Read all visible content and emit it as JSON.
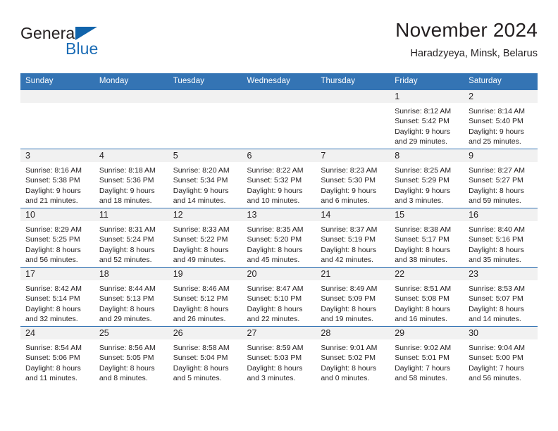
{
  "brand": {
    "name_top": "General",
    "name_bottom": "Blue",
    "triangle_color": "#1164ab",
    "blue_text_color": "#1b6cb5"
  },
  "header": {
    "title": "November 2024",
    "subtitle": "Haradzyeya, Minsk, Belarus"
  },
  "theme": {
    "header_blue": "#3474b4",
    "daynum_gray": "#f1f1f1",
    "text_color": "#231f20"
  },
  "weekdays": [
    "Sunday",
    "Monday",
    "Tuesday",
    "Wednesday",
    "Thursday",
    "Friday",
    "Saturday"
  ],
  "weeks": [
    [
      {
        "day": "",
        "lines": []
      },
      {
        "day": "",
        "lines": []
      },
      {
        "day": "",
        "lines": []
      },
      {
        "day": "",
        "lines": []
      },
      {
        "day": "",
        "lines": []
      },
      {
        "day": "1",
        "lines": [
          "Sunrise: 8:12 AM",
          "Sunset: 5:42 PM",
          "Daylight: 9 hours",
          "and 29 minutes."
        ]
      },
      {
        "day": "2",
        "lines": [
          "Sunrise: 8:14 AM",
          "Sunset: 5:40 PM",
          "Daylight: 9 hours",
          "and 25 minutes."
        ]
      }
    ],
    [
      {
        "day": "3",
        "lines": [
          "Sunrise: 8:16 AM",
          "Sunset: 5:38 PM",
          "Daylight: 9 hours",
          "and 21 minutes."
        ]
      },
      {
        "day": "4",
        "lines": [
          "Sunrise: 8:18 AM",
          "Sunset: 5:36 PM",
          "Daylight: 9 hours",
          "and 18 minutes."
        ]
      },
      {
        "day": "5",
        "lines": [
          "Sunrise: 8:20 AM",
          "Sunset: 5:34 PM",
          "Daylight: 9 hours",
          "and 14 minutes."
        ]
      },
      {
        "day": "6",
        "lines": [
          "Sunrise: 8:22 AM",
          "Sunset: 5:32 PM",
          "Daylight: 9 hours",
          "and 10 minutes."
        ]
      },
      {
        "day": "7",
        "lines": [
          "Sunrise: 8:23 AM",
          "Sunset: 5:30 PM",
          "Daylight: 9 hours",
          "and 6 minutes."
        ]
      },
      {
        "day": "8",
        "lines": [
          "Sunrise: 8:25 AM",
          "Sunset: 5:29 PM",
          "Daylight: 9 hours",
          "and 3 minutes."
        ]
      },
      {
        "day": "9",
        "lines": [
          "Sunrise: 8:27 AM",
          "Sunset: 5:27 PM",
          "Daylight: 8 hours",
          "and 59 minutes."
        ]
      }
    ],
    [
      {
        "day": "10",
        "lines": [
          "Sunrise: 8:29 AM",
          "Sunset: 5:25 PM",
          "Daylight: 8 hours",
          "and 56 minutes."
        ]
      },
      {
        "day": "11",
        "lines": [
          "Sunrise: 8:31 AM",
          "Sunset: 5:24 PM",
          "Daylight: 8 hours",
          "and 52 minutes."
        ]
      },
      {
        "day": "12",
        "lines": [
          "Sunrise: 8:33 AM",
          "Sunset: 5:22 PM",
          "Daylight: 8 hours",
          "and 49 minutes."
        ]
      },
      {
        "day": "13",
        "lines": [
          "Sunrise: 8:35 AM",
          "Sunset: 5:20 PM",
          "Daylight: 8 hours",
          "and 45 minutes."
        ]
      },
      {
        "day": "14",
        "lines": [
          "Sunrise: 8:37 AM",
          "Sunset: 5:19 PM",
          "Daylight: 8 hours",
          "and 42 minutes."
        ]
      },
      {
        "day": "15",
        "lines": [
          "Sunrise: 8:38 AM",
          "Sunset: 5:17 PM",
          "Daylight: 8 hours",
          "and 38 minutes."
        ]
      },
      {
        "day": "16",
        "lines": [
          "Sunrise: 8:40 AM",
          "Sunset: 5:16 PM",
          "Daylight: 8 hours",
          "and 35 minutes."
        ]
      }
    ],
    [
      {
        "day": "17",
        "lines": [
          "Sunrise: 8:42 AM",
          "Sunset: 5:14 PM",
          "Daylight: 8 hours",
          "and 32 minutes."
        ]
      },
      {
        "day": "18",
        "lines": [
          "Sunrise: 8:44 AM",
          "Sunset: 5:13 PM",
          "Daylight: 8 hours",
          "and 29 minutes."
        ]
      },
      {
        "day": "19",
        "lines": [
          "Sunrise: 8:46 AM",
          "Sunset: 5:12 PM",
          "Daylight: 8 hours",
          "and 26 minutes."
        ]
      },
      {
        "day": "20",
        "lines": [
          "Sunrise: 8:47 AM",
          "Sunset: 5:10 PM",
          "Daylight: 8 hours",
          "and 22 minutes."
        ]
      },
      {
        "day": "21",
        "lines": [
          "Sunrise: 8:49 AM",
          "Sunset: 5:09 PM",
          "Daylight: 8 hours",
          "and 19 minutes."
        ]
      },
      {
        "day": "22",
        "lines": [
          "Sunrise: 8:51 AM",
          "Sunset: 5:08 PM",
          "Daylight: 8 hours",
          "and 16 minutes."
        ]
      },
      {
        "day": "23",
        "lines": [
          "Sunrise: 8:53 AM",
          "Sunset: 5:07 PM",
          "Daylight: 8 hours",
          "and 14 minutes."
        ]
      }
    ],
    [
      {
        "day": "24",
        "lines": [
          "Sunrise: 8:54 AM",
          "Sunset: 5:06 PM",
          "Daylight: 8 hours",
          "and 11 minutes."
        ]
      },
      {
        "day": "25",
        "lines": [
          "Sunrise: 8:56 AM",
          "Sunset: 5:05 PM",
          "Daylight: 8 hours",
          "and 8 minutes."
        ]
      },
      {
        "day": "26",
        "lines": [
          "Sunrise: 8:58 AM",
          "Sunset: 5:04 PM",
          "Daylight: 8 hours",
          "and 5 minutes."
        ]
      },
      {
        "day": "27",
        "lines": [
          "Sunrise: 8:59 AM",
          "Sunset: 5:03 PM",
          "Daylight: 8 hours",
          "and 3 minutes."
        ]
      },
      {
        "day": "28",
        "lines": [
          "Sunrise: 9:01 AM",
          "Sunset: 5:02 PM",
          "Daylight: 8 hours",
          "and 0 minutes."
        ]
      },
      {
        "day": "29",
        "lines": [
          "Sunrise: 9:02 AM",
          "Sunset: 5:01 PM",
          "Daylight: 7 hours",
          "and 58 minutes."
        ]
      },
      {
        "day": "30",
        "lines": [
          "Sunrise: 9:04 AM",
          "Sunset: 5:00 PM",
          "Daylight: 7 hours",
          "and 56 minutes."
        ]
      }
    ]
  ]
}
